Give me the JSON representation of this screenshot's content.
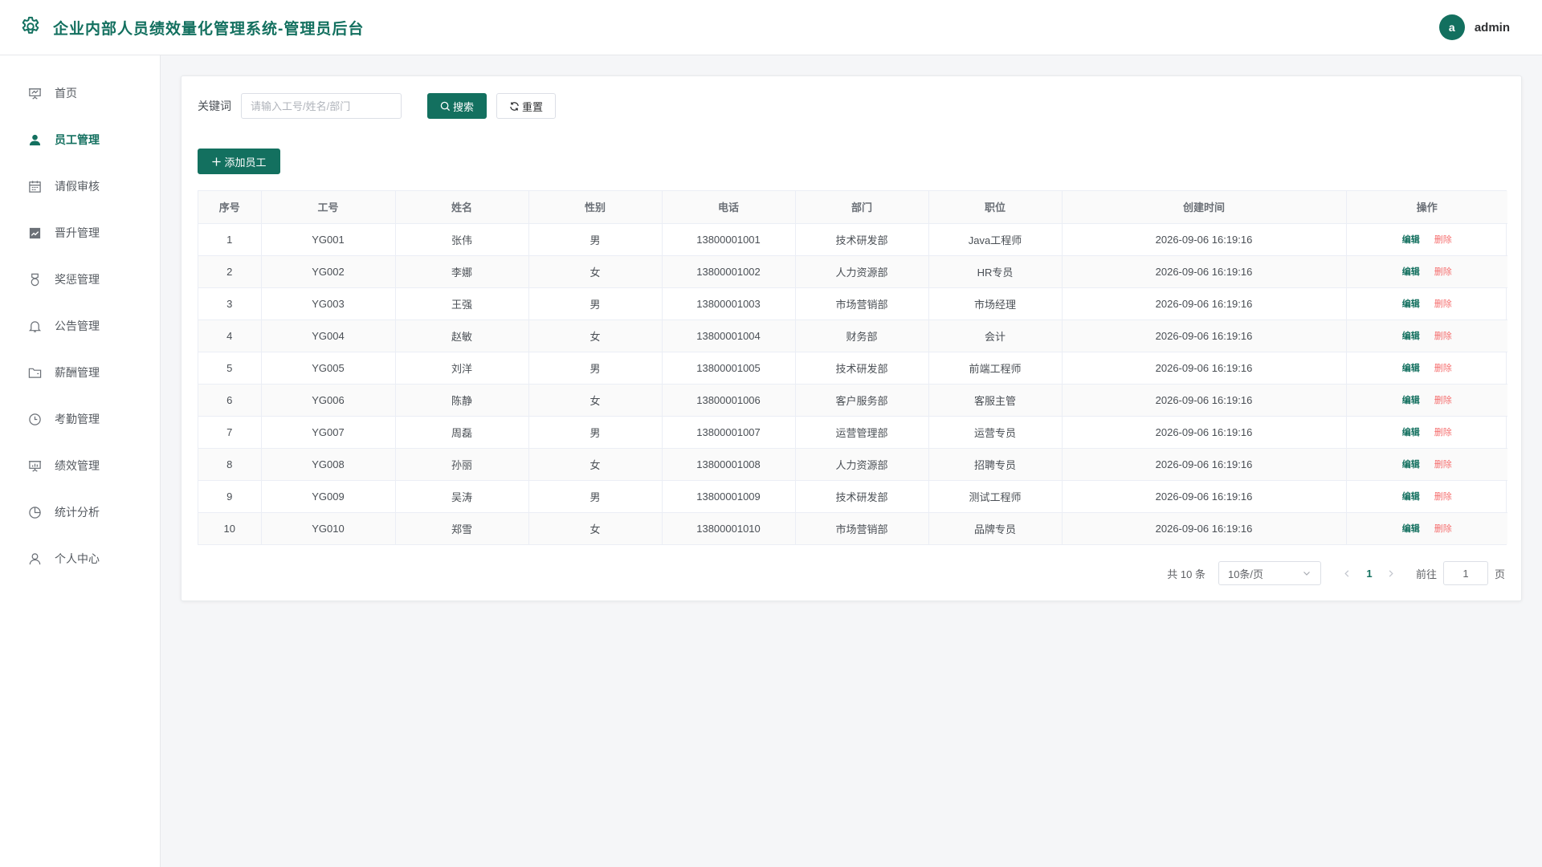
{
  "header": {
    "title": "企业内部人员绩效量化管理系统-管理员后台",
    "avatar_letter": "a",
    "username": "admin"
  },
  "colors": {
    "primary": "#13705f",
    "danger": "#f56c6c"
  },
  "sidebar": {
    "items": [
      {
        "label": "首页",
        "icon": "presentation-board-icon"
      },
      {
        "label": "员工管理",
        "icon": "user-icon",
        "active": true
      },
      {
        "label": "请假审核",
        "icon": "calendar-icon"
      },
      {
        "label": "晋升管理",
        "icon": "trend-chart-icon"
      },
      {
        "label": "奖惩管理",
        "icon": "medal-icon"
      },
      {
        "label": "公告管理",
        "icon": "bell-icon"
      },
      {
        "label": "薪酬管理",
        "icon": "folder-icon"
      },
      {
        "label": "考勤管理",
        "icon": "clock-icon"
      },
      {
        "label": "绩效管理",
        "icon": "data-board-icon"
      },
      {
        "label": "统计分析",
        "icon": "pie-chart-icon"
      },
      {
        "label": "个人中心",
        "icon": "user-outline-icon"
      }
    ]
  },
  "search": {
    "label": "关键词",
    "placeholder": "请输入工号/姓名/部门",
    "value": "",
    "search_label": "搜索",
    "reset_label": "重置"
  },
  "toolbar": {
    "add_label": "添加员工"
  },
  "table": {
    "columns": [
      "序号",
      "工号",
      "姓名",
      "性别",
      "电话",
      "部门",
      "职位",
      "创建时间",
      "操作"
    ],
    "edit_label": "编辑",
    "delete_label": "删除",
    "rows": [
      {
        "idx": "1",
        "id": "YG001",
        "name": "张伟",
        "gender": "男",
        "phone": "13800001001",
        "dept": "技术研发部",
        "position": "Java工程师",
        "created": "2026-09-06 16:19:16"
      },
      {
        "idx": "2",
        "id": "YG002",
        "name": "李娜",
        "gender": "女",
        "phone": "13800001002",
        "dept": "人力资源部",
        "position": "HR专员",
        "created": "2026-09-06 16:19:16"
      },
      {
        "idx": "3",
        "id": "YG003",
        "name": "王强",
        "gender": "男",
        "phone": "13800001003",
        "dept": "市场营销部",
        "position": "市场经理",
        "created": "2026-09-06 16:19:16"
      },
      {
        "idx": "4",
        "id": "YG004",
        "name": "赵敏",
        "gender": "女",
        "phone": "13800001004",
        "dept": "财务部",
        "position": "会计",
        "created": "2026-09-06 16:19:16"
      },
      {
        "idx": "5",
        "id": "YG005",
        "name": "刘洋",
        "gender": "男",
        "phone": "13800001005",
        "dept": "技术研发部",
        "position": "前端工程师",
        "created": "2026-09-06 16:19:16"
      },
      {
        "idx": "6",
        "id": "YG006",
        "name": "陈静",
        "gender": "女",
        "phone": "13800001006",
        "dept": "客户服务部",
        "position": "客服主管",
        "created": "2026-09-06 16:19:16"
      },
      {
        "idx": "7",
        "id": "YG007",
        "name": "周磊",
        "gender": "男",
        "phone": "13800001007",
        "dept": "运营管理部",
        "position": "运营专员",
        "created": "2026-09-06 16:19:16"
      },
      {
        "idx": "8",
        "id": "YG008",
        "name": "孙丽",
        "gender": "女",
        "phone": "13800001008",
        "dept": "人力资源部",
        "position": "招聘专员",
        "created": "2026-09-06 16:19:16"
      },
      {
        "idx": "9",
        "id": "YG009",
        "name": "吴涛",
        "gender": "男",
        "phone": "13800001009",
        "dept": "技术研发部",
        "position": "测试工程师",
        "created": "2026-09-06 16:19:16"
      },
      {
        "idx": "10",
        "id": "YG010",
        "name": "郑雪",
        "gender": "女",
        "phone": "13800001010",
        "dept": "市场营销部",
        "position": "品牌专员",
        "created": "2026-09-06 16:19:16"
      }
    ]
  },
  "pagination": {
    "total_text": "共 10 条",
    "page_size": "10条/页",
    "current_page": "1",
    "goto_label": "前往",
    "goto_value": "1",
    "page_unit": "页"
  }
}
